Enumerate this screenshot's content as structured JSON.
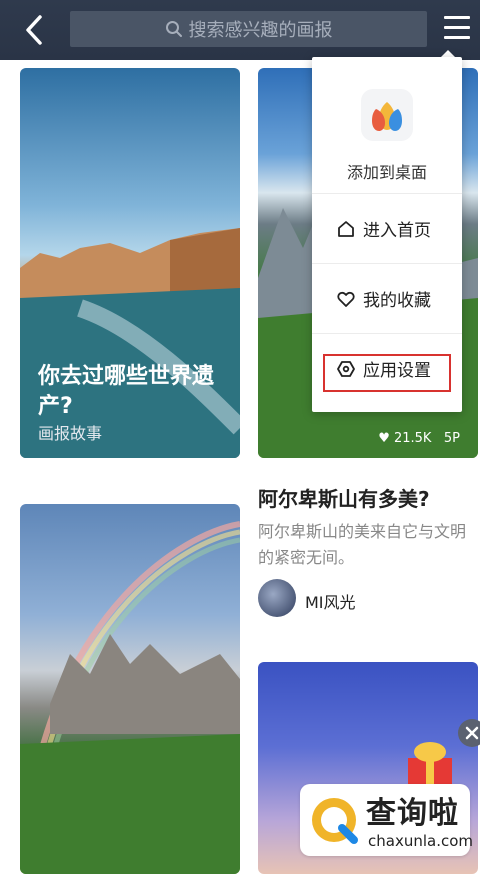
{
  "header": {
    "search_placeholder": "搜索感兴趣的画报"
  },
  "cards": {
    "venice": {
      "title": "你去过哪些世界遗产?",
      "subtitle": "画报故事"
    },
    "alps": {
      "likes": "21.5K",
      "pages": "5P"
    }
  },
  "article": {
    "title": "阿尔卑斯山有多美?",
    "description": "阿尔卑斯山的美来自它与文明的紧密无间。",
    "author": "MI风光"
  },
  "popup_menu": {
    "add_to_home": "添加到桌面",
    "items": [
      {
        "label": "进入首页",
        "icon": "home-icon"
      },
      {
        "label": "我的收藏",
        "icon": "heart-icon"
      },
      {
        "label": "应用设置",
        "icon": "settings-icon"
      }
    ]
  },
  "watermark": {
    "brand": "查询啦",
    "domain": "chaxunla.com"
  },
  "colors": {
    "topbar": "#2f3a4d",
    "highlight": "#d8322f"
  }
}
